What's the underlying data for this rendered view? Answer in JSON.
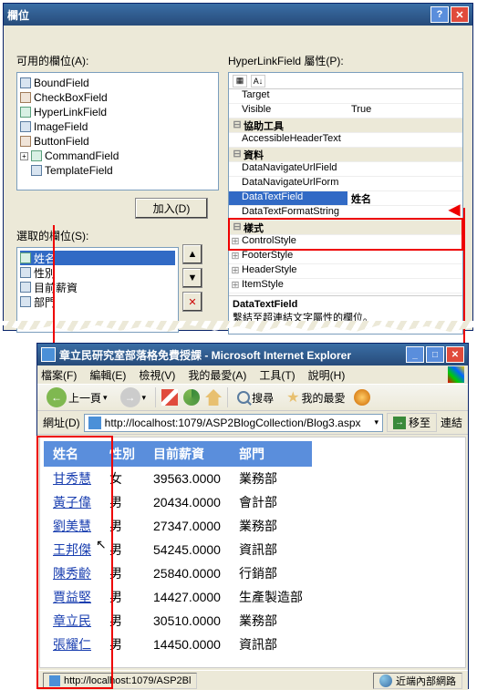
{
  "dialog": {
    "title": "欄位",
    "available_label": "可用的欄位(A):",
    "properties_label": "HyperLinkField 屬性(P):",
    "add_button": "加入(D)",
    "selected_label": "選取的欄位(S):",
    "available_fields": [
      "BoundField",
      "CheckBoxField",
      "HyperLinkField",
      "ImageField",
      "ButtonField",
      "CommandField",
      "TemplateField"
    ],
    "selected_fields": [
      "姓名",
      "性別",
      "目前薪資",
      "部門"
    ],
    "props": {
      "Target": "",
      "Visible": "True",
      "cat_help": "協助工具",
      "AccessibleHeaderText": "",
      "cat_data": "資料",
      "DataNavigateUrlField": "",
      "DataNavigateUrlForm": "",
      "DataTextField": "姓名",
      "DataTextFormatString": "",
      "cat_style": "樣式",
      "ControlStyle": "",
      "FooterStyle": "",
      "HeaderStyle": "",
      "ItemStyle": ""
    },
    "desc_title": "DataTextField",
    "desc_text": "繫結至超連結文字屬性的欄位。"
  },
  "browser": {
    "title": "章立民研究室部落格免費授課 - Microsoft Internet Explorer",
    "menu": [
      "檔案(F)",
      "編輯(E)",
      "檢視(V)",
      "我的最愛(A)",
      "工具(T)",
      "說明(H)"
    ],
    "back": "上一頁",
    "search": "搜尋",
    "fav": "我的最愛",
    "addr_label": "網址(D)",
    "url": "http://localhost:1079/ASP2BlogCollection/Blog3.aspx",
    "go": "移至",
    "links": "連結",
    "table": {
      "headers": [
        "姓名",
        "性別",
        "目前薪資",
        "部門"
      ],
      "rows": [
        {
          "name": "甘秀慧",
          "gender": "女",
          "salary": "39563.0000",
          "dept": "業務部"
        },
        {
          "name": "黃子偉",
          "gender": "男",
          "salary": "20434.0000",
          "dept": "會計部"
        },
        {
          "name": "劉美慧",
          "gender": "男",
          "salary": "27347.0000",
          "dept": "業務部"
        },
        {
          "name": "王邦傑",
          "gender": "男",
          "salary": "54245.0000",
          "dept": "資訊部"
        },
        {
          "name": "陳秀齡",
          "gender": "男",
          "salary": "25840.0000",
          "dept": "行銷部"
        },
        {
          "name": "賈益堅",
          "gender": "男",
          "salary": "14427.0000",
          "dept": "生產製造部"
        },
        {
          "name": "章立民",
          "gender": "男",
          "salary": "30510.0000",
          "dept": "業務部"
        },
        {
          "name": "張耀仁",
          "gender": "男",
          "salary": "14450.0000",
          "dept": "資訊部"
        }
      ]
    },
    "status_left": "http://localhost:1079/ASP2Bl",
    "status_right": "近端內部網路"
  }
}
